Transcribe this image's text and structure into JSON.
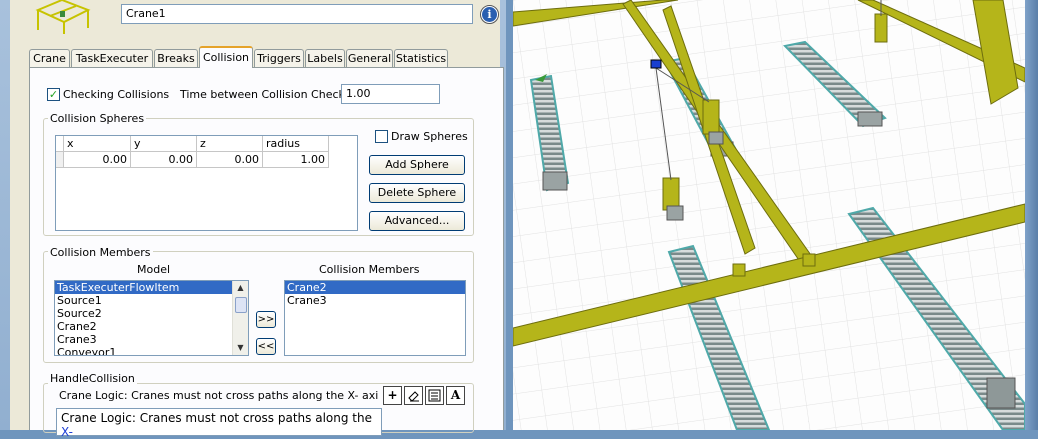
{
  "object": {
    "name": "Crane1"
  },
  "tabs": [
    "Crane",
    "TaskExecuter",
    "Breaks",
    "Collision",
    "Triggers",
    "Labels",
    "General",
    "Statistics"
  ],
  "active_tab": "Collision",
  "collision": {
    "checking_label": "Checking Collisions",
    "checking_checked": true,
    "checking_mark": "✓",
    "interval_label": "Time between Collision Checks:",
    "interval_value": "1.00",
    "spheres_group": "Collision Spheres",
    "grid_headers": [
      "x",
      "y",
      "z",
      "radius"
    ],
    "grid_rows": [
      [
        "0.00",
        "0.00",
        "0.00",
        "1.00"
      ]
    ],
    "draw_spheres_label": "Draw Spheres",
    "add_sphere": "Add Sphere",
    "delete_sphere": "Delete Sphere",
    "advanced": "Advanced...",
    "members_group": "Collision Members",
    "model_header": "Model",
    "members_header": "Collision Members",
    "model_list": [
      "TaskExecuterFlowItem",
      "Source1",
      "Source2",
      "Crane2",
      "Crane3",
      "Conveyor1"
    ],
    "model_selected": "TaskExecuterFlowItem",
    "members_list": [
      "Crane2",
      "Crane3"
    ],
    "members_selected": "Crane2",
    "add_member_btn": ">>",
    "remove_member_btn": "<<",
    "handle_group": "HandleCollision",
    "handle_summary": "Crane Logic:  Cranes must not cross paths along the X- axis.  If a c",
    "handle_code_line1": "Crane Logic:  Cranes must not cross paths along the ",
    "handle_code_highlight": "X-"
  },
  "toolbar_icons": [
    "plus-icon",
    "eraser-icon",
    "properties-icon",
    "text-edit-icon"
  ],
  "colors": {
    "crane_frame": "#b5b51a",
    "selection": "#316ac5",
    "tab_highlight": "#e5a32a"
  }
}
